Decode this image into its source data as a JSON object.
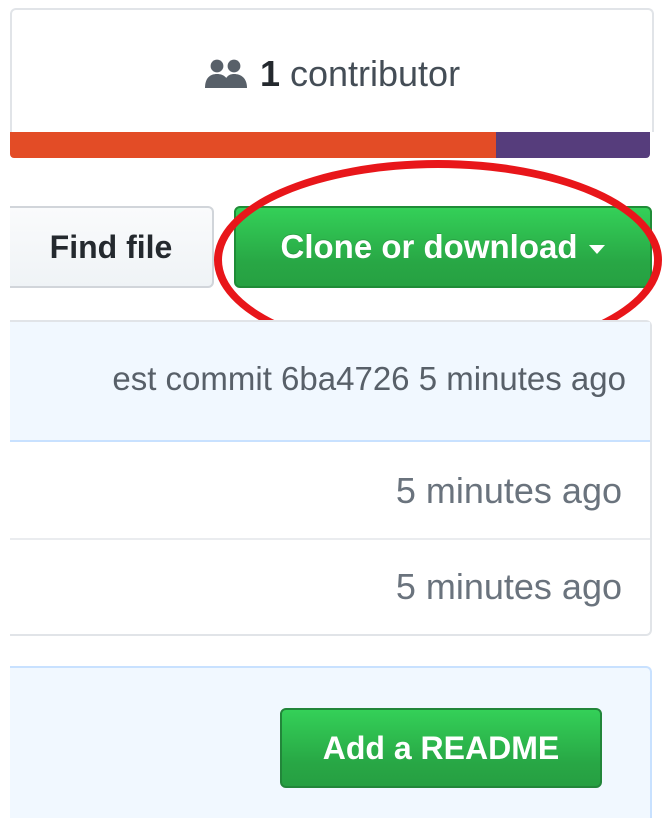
{
  "colors": {
    "accent_green": "#28a745",
    "highlight_red": "#e8161a",
    "lang_primary": "#e34c26",
    "lang_secondary": "#563d7c"
  },
  "contributors": {
    "icon": "people-icon",
    "count": "1",
    "label": "contributor"
  },
  "language_bar": {
    "segments": [
      {
        "color": "#e34c26",
        "fraction": 0.76
      },
      {
        "color": "#563d7c",
        "fraction": 0.24
      }
    ]
  },
  "toolbar": {
    "find_file_label": "Find file",
    "clone_label": "Clone or download",
    "clone_caret_icon": "caret-down-icon"
  },
  "commit": {
    "text": "est commit 6ba4726 5 minutes ago"
  },
  "files": [
    {
      "time": "5 minutes ago"
    },
    {
      "time": "5 minutes ago"
    }
  ],
  "readme": {
    "button_label": "Add a README"
  }
}
